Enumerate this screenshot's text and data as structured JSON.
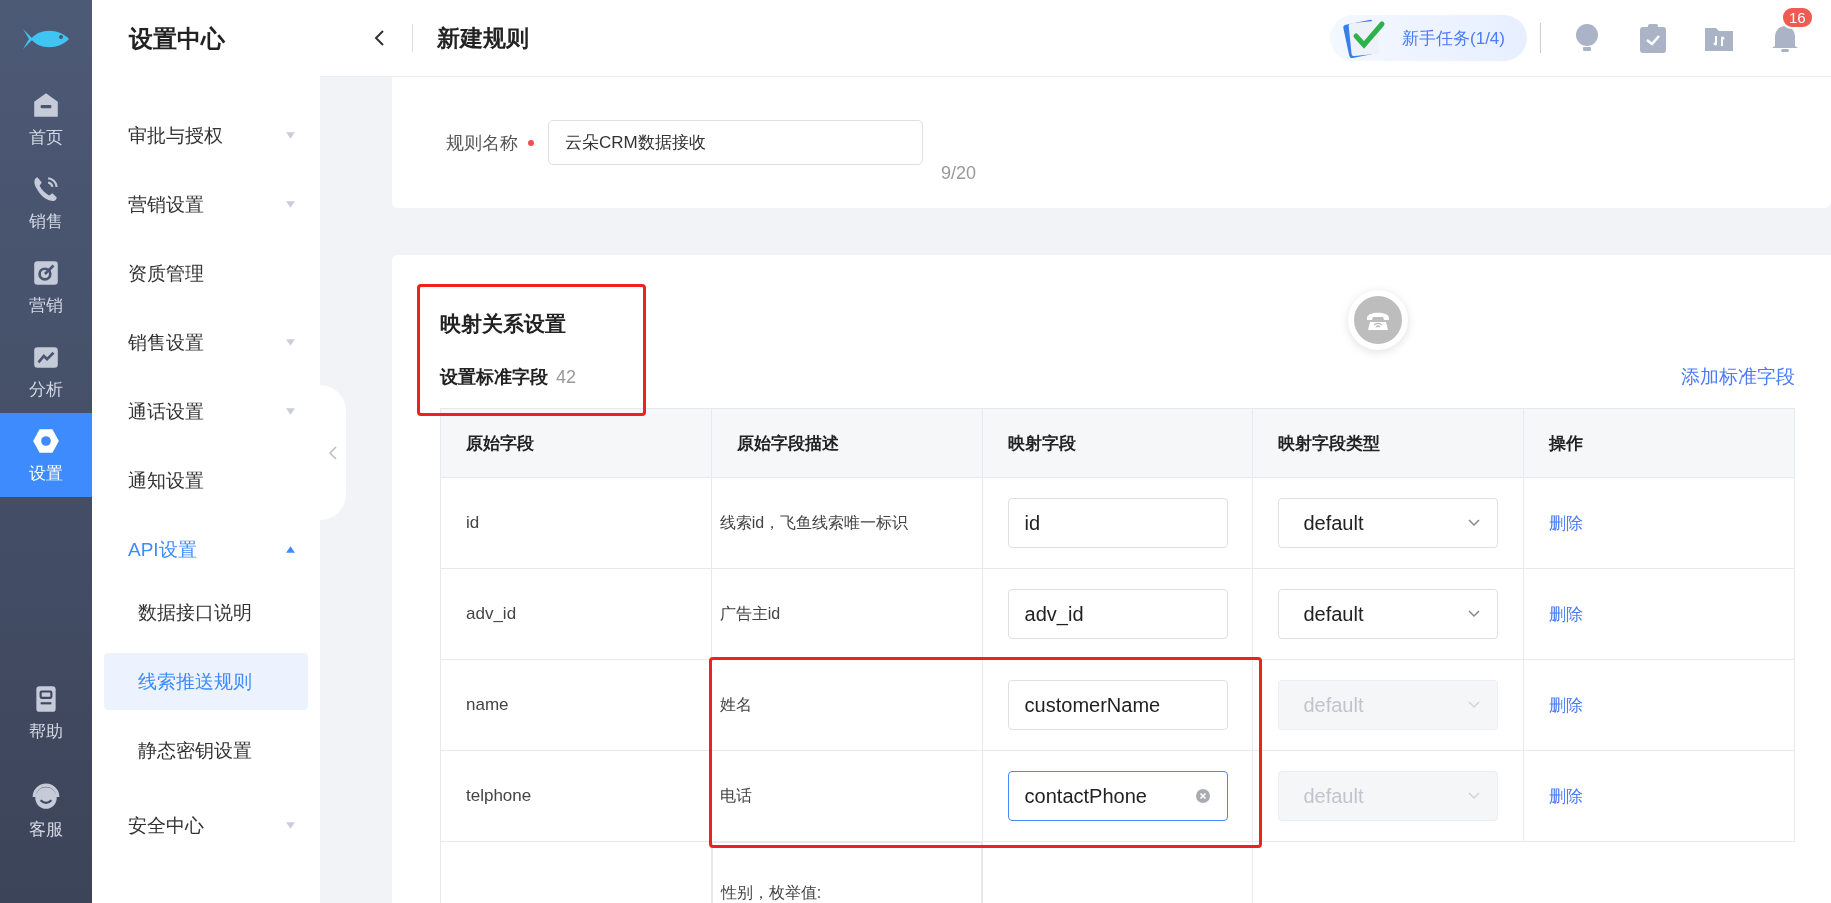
{
  "rail": {
    "items": [
      {
        "label": "首页",
        "selected": false
      },
      {
        "label": "销售",
        "selected": false
      },
      {
        "label": "营销",
        "selected": false
      },
      {
        "label": "分析",
        "selected": false
      },
      {
        "label": "设置",
        "selected": true
      }
    ],
    "bottom_items": [
      {
        "label": "帮助",
        "selected": false
      },
      {
        "label": "客服",
        "selected": false
      }
    ]
  },
  "sidebar": {
    "title": "设置中心",
    "items": [
      {
        "kind": "group",
        "label": "审批与授权",
        "expanded": false
      },
      {
        "kind": "group",
        "label": "营销设置",
        "expanded": false
      },
      {
        "kind": "page",
        "label": "资质管理",
        "selected": false
      },
      {
        "kind": "group",
        "label": "销售设置",
        "expanded": false
      },
      {
        "kind": "group",
        "label": "通话设置",
        "expanded": false
      },
      {
        "kind": "page",
        "label": "通知设置",
        "selected": false
      },
      {
        "kind": "group",
        "label": "API设置",
        "expanded": true,
        "children": [
          {
            "label": "数据接口说明",
            "selected": false
          },
          {
            "label": "线索推送规则",
            "selected": true
          },
          {
            "label": "静态密钥设置",
            "selected": false
          }
        ]
      },
      {
        "kind": "group",
        "label": "安全中心",
        "expanded": false
      }
    ]
  },
  "topbar": {
    "title": "新建规则",
    "task": "新手任务(1/4)",
    "badge": "16"
  },
  "basic": {
    "field_label": "规则名称",
    "required": true,
    "value": "云朵CRM数据接收",
    "count": "9/20"
  },
  "mapping": {
    "title": "映射关系设置",
    "subtitle": "设置标准字段",
    "count": "42",
    "add_link": "添加标准字段",
    "table": {
      "columns": [
        "原始字段",
        "原始字段描述",
        "映射字段",
        "映射字段类型",
        "操作"
      ],
      "rows": [
        {
          "kind": "full",
          "source": "id",
          "description": "线索id，飞鱼线索唯一标识",
          "mapped": "id",
          "focused": false,
          "type": "default",
          "type_disabled": false,
          "action": "删除"
        },
        {
          "kind": "full",
          "source": "adv_id",
          "description": "广告主id",
          "mapped": "adv_id",
          "focused": false,
          "type": "default",
          "type_disabled": false,
          "action": "删除"
        },
        {
          "kind": "full",
          "source": "name",
          "description": "姓名",
          "mapped": "customerName",
          "focused": false,
          "type": "default",
          "type_disabled": true,
          "action": "删除"
        },
        {
          "kind": "full",
          "source": "telphone",
          "description": "电话",
          "mapped": "contactPhone",
          "focused": true,
          "type": "default",
          "type_disabled": true,
          "action": "删除"
        },
        {
          "kind": "partial",
          "description": "性别，枚举值:"
        }
      ]
    }
  }
}
